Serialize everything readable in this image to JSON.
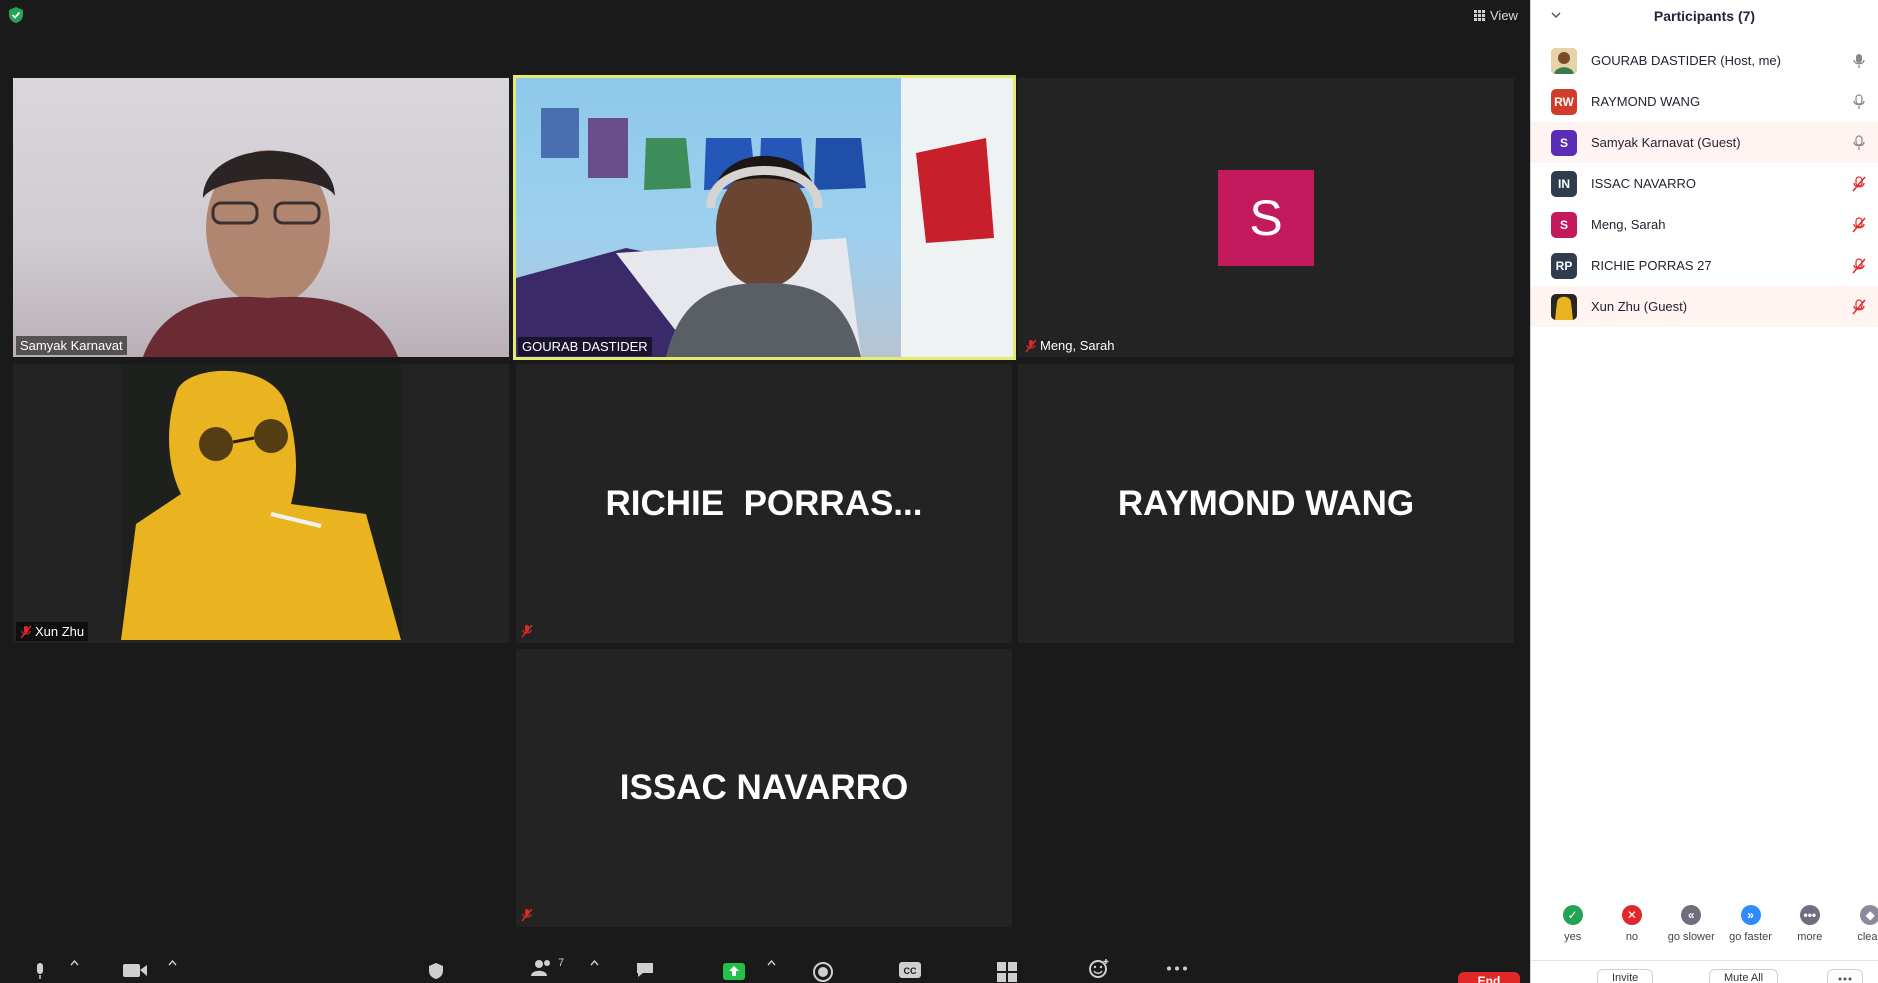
{
  "meeting": {
    "view_label": "View",
    "tiles": [
      {
        "name": "Samyak Karnavat",
        "type": "video"
      },
      {
        "name": "GOURAB DASTIDER",
        "type": "video",
        "active": true
      },
      {
        "name": "Meng, Sarah",
        "type": "avatar",
        "avatar_letter": "S",
        "muted": true
      },
      {
        "name": "Xun Zhu",
        "type": "video",
        "muted": true
      },
      {
        "name": "RICHIE  PORRAS...",
        "type": "name-only",
        "muted": true
      },
      {
        "name": "RAYMOND WANG",
        "type": "name-only"
      },
      {
        "name": "ISSAC NAVARRO",
        "type": "name-only",
        "muted": true
      }
    ]
  },
  "toolbar": {
    "participants_count": "7",
    "end_label": "End"
  },
  "panel": {
    "title": "Participants (7)",
    "participants": [
      {
        "name": "GOURAB DASTIDER (Host, me)",
        "initials": "",
        "avatar_color": "#8a6a4a",
        "mic": "on"
      },
      {
        "name": "RAYMOND WANG",
        "initials": "RW",
        "avatar_color": "#d03b2a",
        "mic": "on"
      },
      {
        "name": "Samyak Karnavat (Guest)",
        "initials": "S",
        "avatar_color": "#5b2db5",
        "mic": "on"
      },
      {
        "name": "ISSAC NAVARRO",
        "initials": "IN",
        "avatar_color": "#2f3d4f",
        "mic": "muted"
      },
      {
        "name": "Meng, Sarah",
        "initials": "S",
        "avatar_color": "#c21a5c",
        "mic": "muted"
      },
      {
        "name": "RICHIE PORRAS 27",
        "initials": "RP",
        "avatar_color": "#2f3d4f",
        "mic": "muted"
      },
      {
        "name": "Xun Zhu (Guest)",
        "initials": "",
        "avatar_color": "#c89a2a",
        "mic": "muted"
      }
    ],
    "reactions": [
      {
        "label": "yes",
        "icon": "check-icon",
        "color": "#23a455"
      },
      {
        "label": "no",
        "icon": "x-icon",
        "color": "#e02828"
      },
      {
        "label": "go slower",
        "icon": "rewind-icon",
        "color": "#6e6e7e"
      },
      {
        "label": "go faster",
        "icon": "fast-forward-icon",
        "color": "#2d8cff"
      },
      {
        "label": "more",
        "icon": "more-icon",
        "color": "#6e6e7e"
      },
      {
        "label": "clear",
        "icon": "clear-icon",
        "color": "#8a8a9a"
      }
    ],
    "footer": {
      "invite_label": "Invite",
      "mute_all_label": "Mute All"
    }
  }
}
